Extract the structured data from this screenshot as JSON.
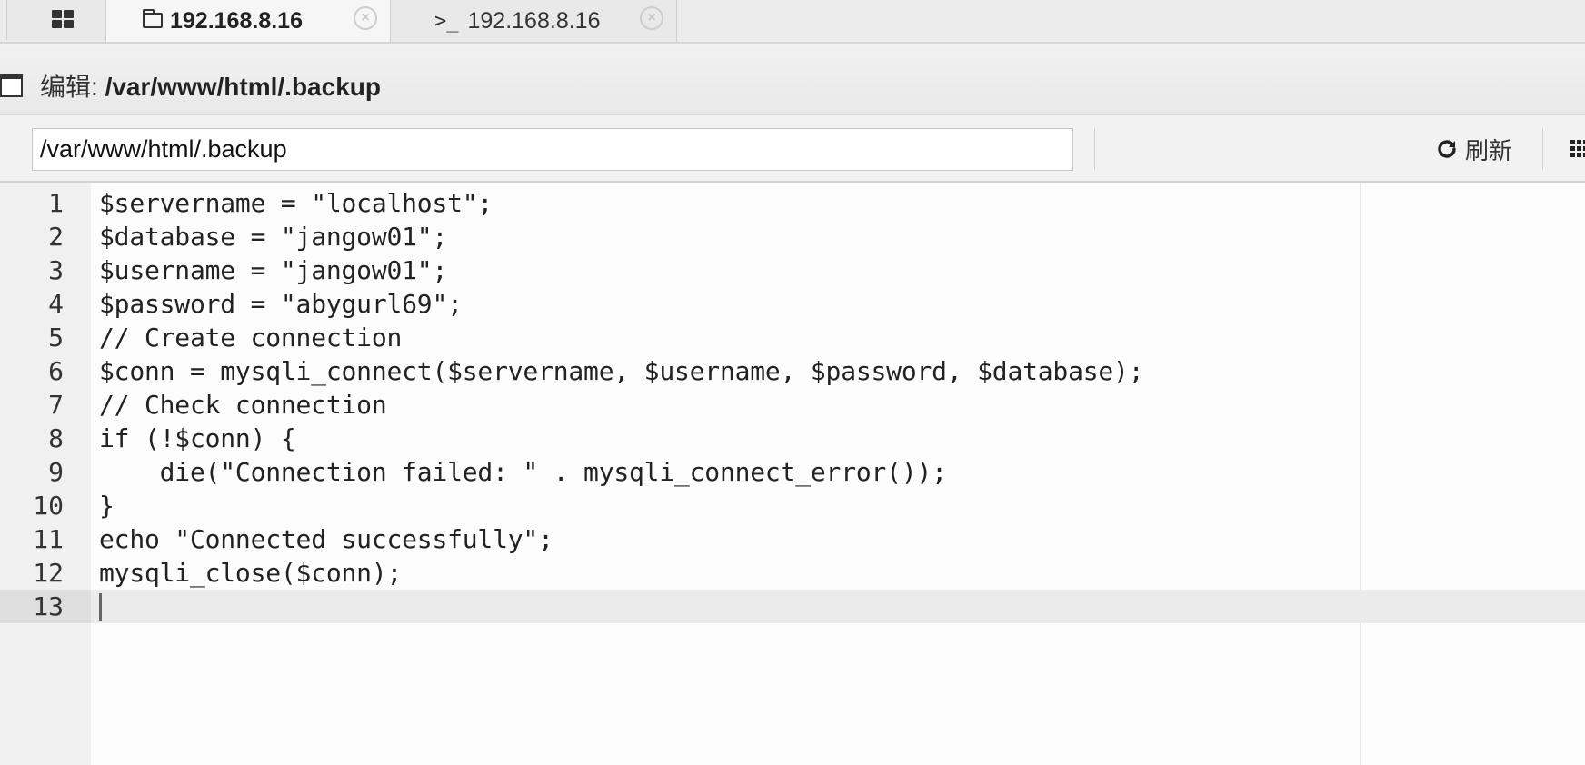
{
  "tabs": [
    {
      "title": "192.168.8.16",
      "icon": "folder-icon",
      "active": true
    },
    {
      "title": "192.168.8.16",
      "icon": "terminal-icon",
      "active": false
    }
  ],
  "terminal_prompt_glyph": ">_",
  "close_glyph": "×",
  "editor_title": {
    "label": "编辑: ",
    "path": "/var/www/html/.backup"
  },
  "toolbar": {
    "path_value": "/var/www/html/.backup",
    "refresh_label": "刷新"
  },
  "code_lines": [
    {
      "n": "1",
      "text": "$servername = \"localhost\";"
    },
    {
      "n": "2",
      "text": "$database = \"jangow01\";"
    },
    {
      "n": "3",
      "text": "$username = \"jangow01\";"
    },
    {
      "n": "4",
      "text": "$password = \"abygurl69\";"
    },
    {
      "n": "5",
      "text": "// Create connection"
    },
    {
      "n": "6",
      "text": "$conn = mysqli_connect($servername, $username, $password, $database);"
    },
    {
      "n": "7",
      "text": "// Check connection"
    },
    {
      "n": "8",
      "text": "if (!$conn) {"
    },
    {
      "n": "9",
      "text": "    die(\"Connection failed: \" . mysqli_connect_error());"
    },
    {
      "n": "10",
      "text": "}"
    },
    {
      "n": "11",
      "text": "echo \"Connected successfully\";"
    },
    {
      "n": "12",
      "text": "mysqli_close($conn);"
    },
    {
      "n": "13",
      "text": ""
    }
  ],
  "active_line": "13"
}
